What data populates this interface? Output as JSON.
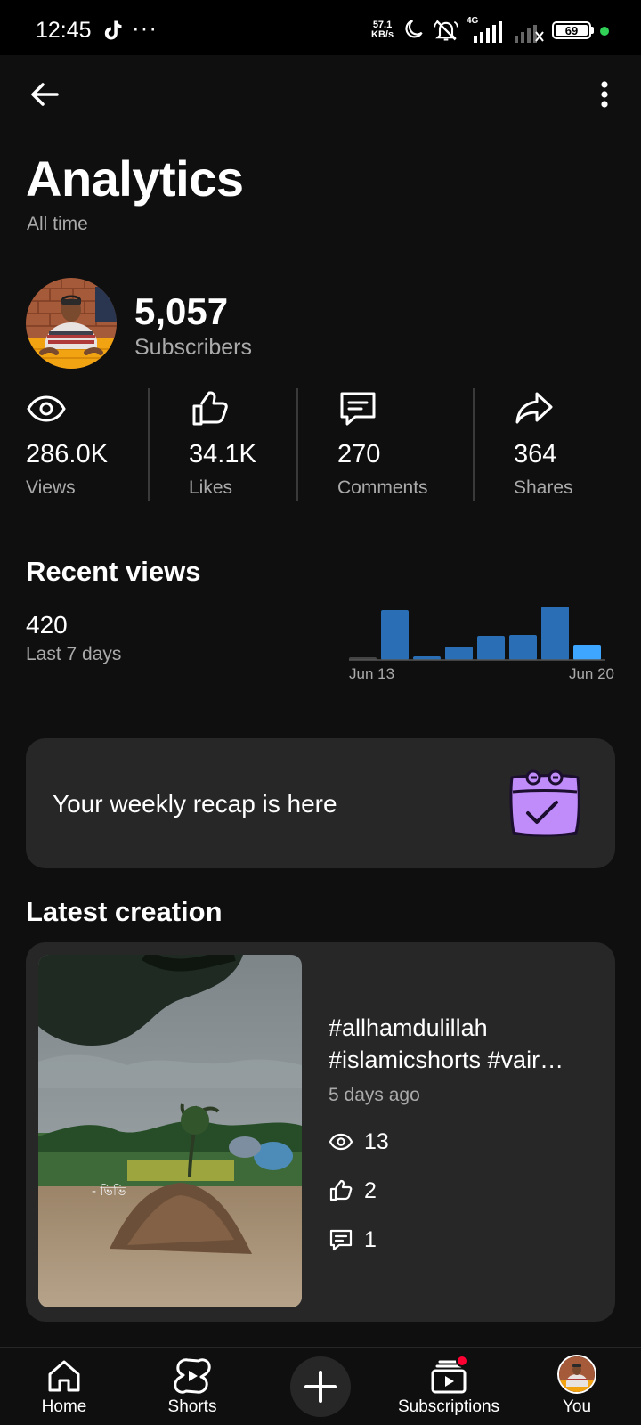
{
  "status_bar": {
    "time": "12:45",
    "overflow_dots": "···",
    "net_speed_value": "57.1",
    "net_speed_unit": "KB/s",
    "network_type": "4G",
    "battery_level": "69",
    "battery_indicator_color": "#31d158"
  },
  "header": {
    "title": "Analytics",
    "subtitle": "All time"
  },
  "subscribers": {
    "count": "5,057",
    "label": "Subscribers"
  },
  "metrics": [
    {
      "icon": "eye-icon",
      "value": "286.0K",
      "label": "Views"
    },
    {
      "icon": "thumbs-up-icon",
      "value": "34.1K",
      "label": "Likes"
    },
    {
      "icon": "comment-icon",
      "value": "270",
      "label": "Comments"
    },
    {
      "icon": "share-icon",
      "value": "364",
      "label": "Shares"
    }
  ],
  "recent_views": {
    "title": "Recent views",
    "value": "420",
    "label": "Last 7 days"
  },
  "chart_data": {
    "type": "bar",
    "categories": [
      "",
      "",
      "",
      "",
      "",
      "",
      "",
      ""
    ],
    "values": [
      3,
      56,
      4,
      15,
      27,
      28,
      60,
      17
    ],
    "x_tick_labels": [
      "Jun 13",
      "Jun 20"
    ],
    "colors": {
      "bar": "#2a6eb5",
      "bar_latest": "#3ea6ff",
      "baseline": "#555555"
    },
    "grid": false
  },
  "recap": {
    "text": "Your weekly recap is here",
    "icon": "calendar-check-icon",
    "icon_color": "#c08cf9"
  },
  "latest_creation": {
    "section_title": "Latest creation",
    "title_line1": "#allhamdulillah",
    "title_line2": "#islamicshorts #vair…",
    "age": "5 days ago",
    "views": "13",
    "likes": "2",
    "comments": "1",
    "thumbnail_overlay_text": "- ভিভি"
  },
  "bottom_nav": {
    "home": "Home",
    "shorts": "Shorts",
    "create_icon": "plus-icon",
    "subscriptions": "Subscriptions",
    "you": "You",
    "notification_dot_color": "#ff0033"
  }
}
